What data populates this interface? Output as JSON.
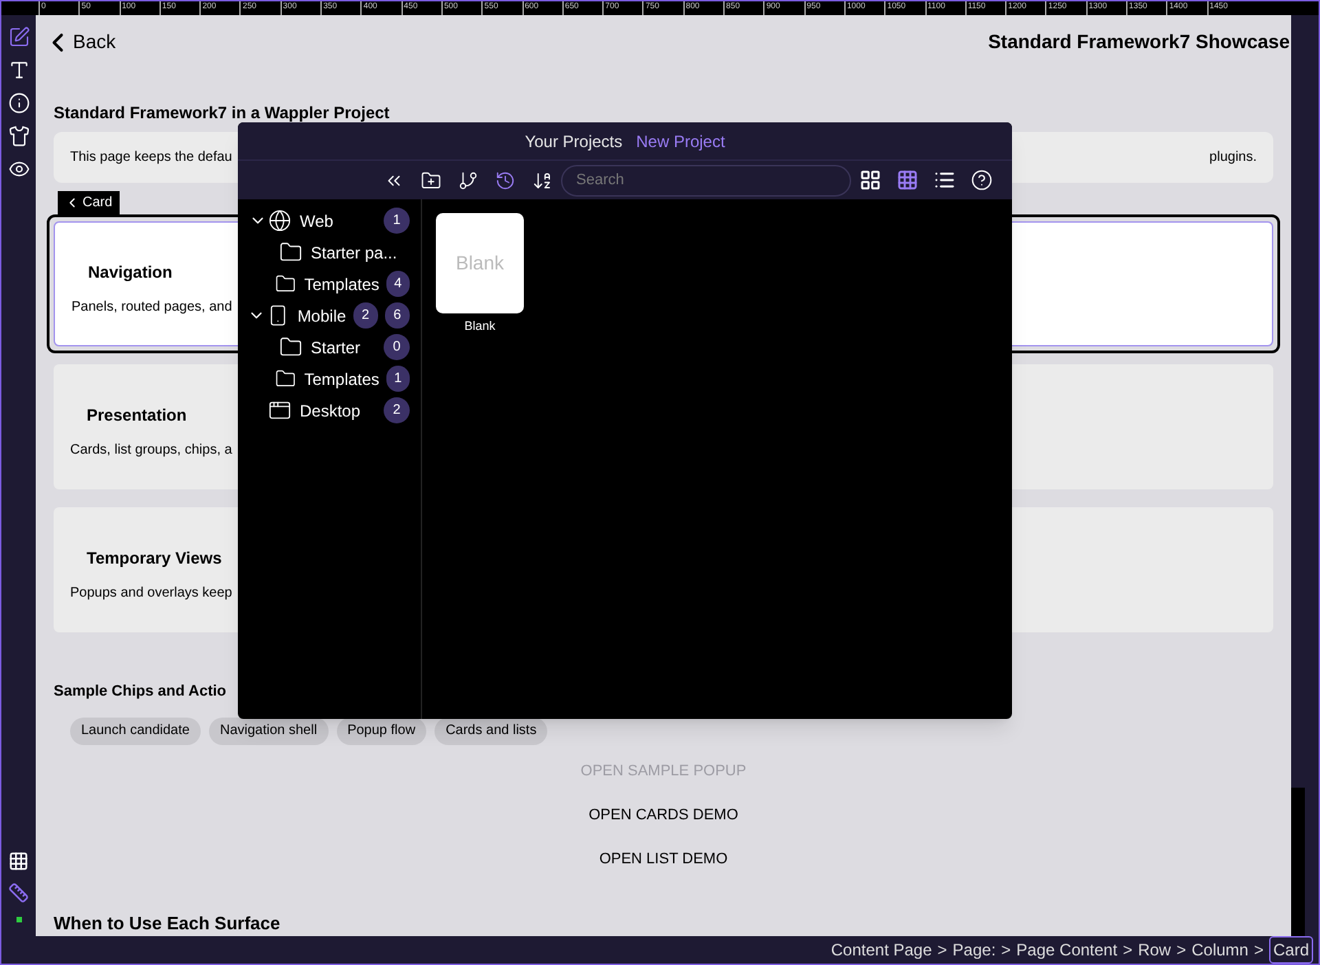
{
  "ruler": [
    "0",
    "50",
    "100",
    "150",
    "200",
    "250",
    "300",
    "350",
    "400",
    "450",
    "500",
    "550",
    "600",
    "650",
    "700",
    "750",
    "800",
    "850",
    "900",
    "950",
    "1000",
    "1050",
    "1100",
    "1150",
    "1200",
    "1250",
    "1300",
    "1350",
    "1400",
    "1450"
  ],
  "tools": [
    {
      "kind": "edit",
      "selected": true
    },
    {
      "kind": "text",
      "selected": false
    },
    {
      "kind": "info",
      "selected": false
    },
    {
      "kind": "shirt",
      "selected": false
    },
    {
      "kind": "eye",
      "selected": false
    }
  ],
  "page": {
    "back": "Back",
    "title": "Standard Framework7 Showcase",
    "heading": "Standard Framework7 in a Wappler Project",
    "intro_left": "This page keeps the defau",
    "intro_right": "plugins.",
    "element_tag": "Card",
    "cards": [
      {
        "title": "Navigation",
        "text": "Panels, routed pages, and",
        "selected": true
      },
      {
        "title": "Presentation",
        "text": "Cards, list groups, chips, a",
        "selected": false
      },
      {
        "title": "Temporary Views",
        "text": "Popups and overlays keep",
        "selected": false
      }
    ],
    "chips_heading": "Sample Chips and Actio",
    "chips": [
      "Launch candidate",
      "Navigation shell",
      "Popup flow",
      "Cards and lists"
    ],
    "actions": [
      {
        "label": "OPEN SAMPLE POPUP",
        "disabled": true
      },
      {
        "label": "OPEN CARDS DEMO",
        "disabled": false
      },
      {
        "label": "OPEN LIST DEMO",
        "disabled": false
      }
    ],
    "footer_heading": "When to Use Each Surface"
  },
  "dialog": {
    "tabs": [
      {
        "label": "Your Projects",
        "selected": true
      },
      {
        "label": "New Project",
        "selected": false
      }
    ],
    "tools": [
      {
        "kind": "collapse",
        "selected": false
      },
      {
        "kind": "new-folder",
        "selected": false
      },
      {
        "kind": "branch",
        "selected": false
      },
      {
        "kind": "history",
        "selected": true
      },
      {
        "kind": "sort",
        "selected": false
      }
    ],
    "search": {
      "placeholder": "Search"
    },
    "views": [
      {
        "kind": "large",
        "selected": false
      },
      {
        "kind": "small",
        "selected": true
      },
      {
        "kind": "list",
        "selected": false
      },
      {
        "kind": "help",
        "selected": false
      }
    ],
    "tree": [
      {
        "label": "Web",
        "kind": "globe",
        "expanded": true,
        "counts": [
          "1"
        ],
        "children": [
          {
            "label": "Starter pa...",
            "kind": "folder"
          },
          {
            "label": "Templates",
            "kind": "folder",
            "counts": [
              "4"
            ]
          }
        ]
      },
      {
        "label": "Mobile",
        "kind": "phone",
        "expanded": true,
        "counts": [
          "2",
          "6"
        ],
        "children": [
          {
            "label": "Starter",
            "kind": "folder",
            "counts": [
              "0"
            ]
          },
          {
            "label": "Templates",
            "kind": "folder",
            "counts": [
              "1"
            ]
          }
        ]
      },
      {
        "label": "Desktop",
        "kind": "window",
        "counts": [
          "2"
        ]
      }
    ],
    "items": [
      {
        "thumb": "Blank",
        "label": "Blank"
      }
    ]
  },
  "status_bar": {
    "separator": ">",
    "crumbs": [
      {
        "label": "Content Page",
        "selected": false
      },
      {
        "label": "Page:",
        "selected": false
      },
      {
        "label": "Page Content",
        "selected": false
      },
      {
        "label": "Row",
        "selected": false
      },
      {
        "label": "Column",
        "selected": false
      },
      {
        "label": "Card",
        "selected": true
      }
    ]
  }
}
